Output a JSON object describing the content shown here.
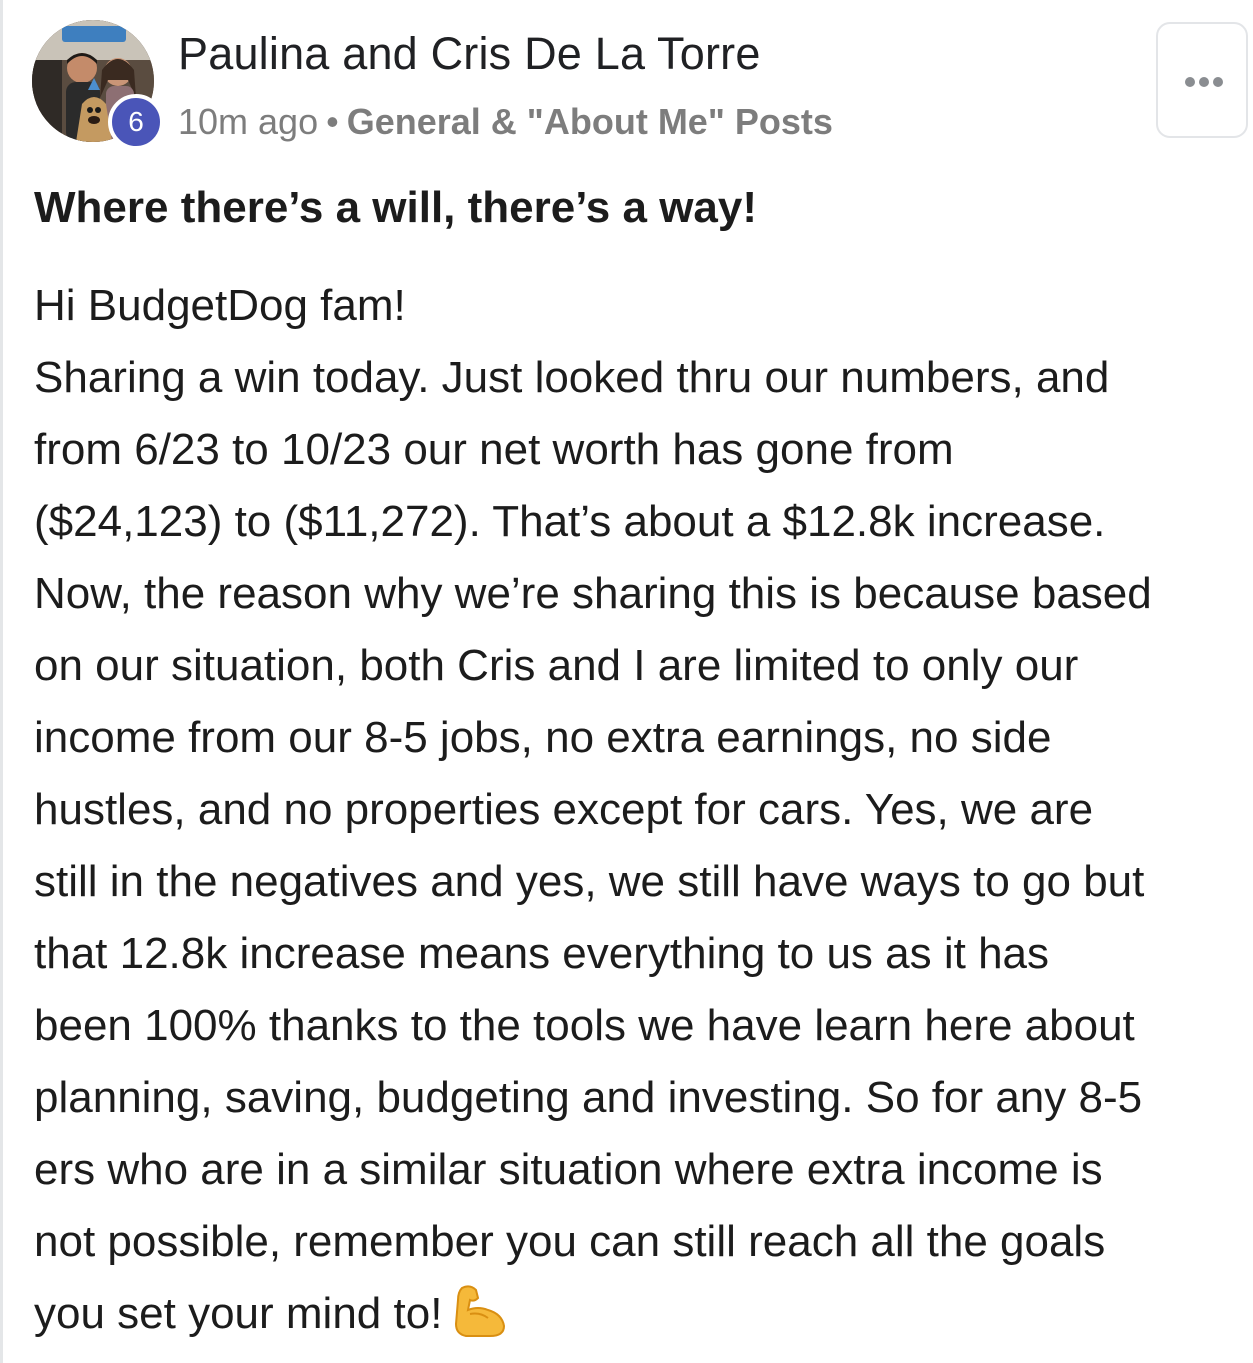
{
  "post": {
    "author": {
      "name": "Paulina and Cris De La Torre",
      "avatar_icon": "profile-photo",
      "level": "6",
      "level_color": "#4a55b8"
    },
    "timestamp": "10m ago",
    "separator": "•",
    "category": "General & \"About Me\" Posts",
    "more_icon": "more-horizontal-icon",
    "title": "Where there’s a will, there’s a way!",
    "body_lines": [
      "Hi BudgetDog fam!",
      "Sharing a win today. Just looked thru our numbers, and",
      "from 6/23 to 10/23 our net worth has gone from",
      "($24,123) to ($11,272). That’s about a $12.8k increase.",
      "Now, the reason why we’re sharing this is because based",
      "on our situation, both Cris and I are limited to only our",
      "income from our 8-5 jobs, no extra earnings, no side",
      "hustles, and no properties except for cars. Yes, we are",
      "still in the negatives and yes, we still have ways to go but",
      "that 12.8k increase means everything to us as it has",
      "been 100% thanks to the tools we have learn here about",
      "planning, saving, budgeting and investing. So for any 8-5",
      "ers who are in a similar situation where extra income is",
      "not possible, remember you can still reach all the goals",
      "you set your mind to!"
    ],
    "closing_emoji_icon": "flexed-biceps-icon"
  }
}
